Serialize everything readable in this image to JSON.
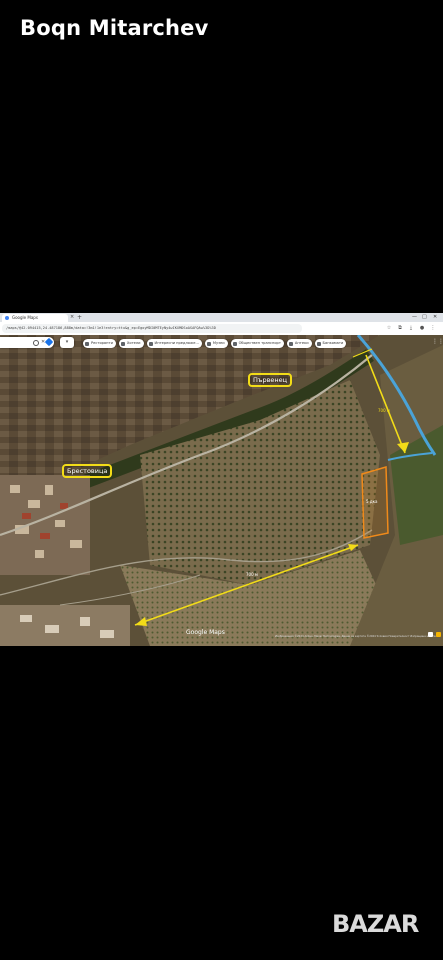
{
  "post": {
    "author": "Boqn Mitarchev"
  },
  "browser": {
    "tab_title": "Google Maps",
    "new_tab": "+",
    "tab_close": "×",
    "address": "/maps/@42.094415,24.487186,888m/data=!3m1!1e3!entry=ttu&g_ep=EgoyMDI0MTEyNy4wIKXMDSoASAFQAw%3D%3D",
    "toolbar_icons": [
      "star-icon",
      "extensions-icon",
      "download-icon",
      "profile-icon",
      "menu-icon"
    ]
  },
  "map": {
    "search_placeholder": "",
    "layers_label": "▾",
    "chips": [
      {
        "label": "Ресторанти",
        "icon": "restaurant-icon"
      },
      {
        "label": "Хотели",
        "icon": "hotel-icon"
      },
      {
        "label": "Интересни предложе...",
        "icon": "attraction-icon"
      },
      {
        "label": "Музеи",
        "icon": "museum-icon"
      },
      {
        "label": "Обществен транспорт",
        "icon": "transit-icon"
      },
      {
        "label": "Аптеки",
        "icon": "pharmacy-icon"
      },
      {
        "label": "Банкомати",
        "icon": "atm-icon"
      }
    ],
    "labels": {
      "village_1": "Първенец",
      "village_2": "Брестовица"
    },
    "measurements": {
      "top_right": "700 м",
      "plot": "5 дка",
      "bottom": "700 м"
    },
    "google_logo": "Google Maps",
    "attribution": "Изображения ©2024 Airbus, Maxar Technologies, Данни за картата ©2024 Условия  Поверителност  Изпращане на отзиви"
  },
  "colors": {
    "highlight_yellow": "#f2dc18",
    "plot_orange": "#f08a1a",
    "river_blue": "#4aa3d8"
  },
  "watermark": "BAZAR"
}
